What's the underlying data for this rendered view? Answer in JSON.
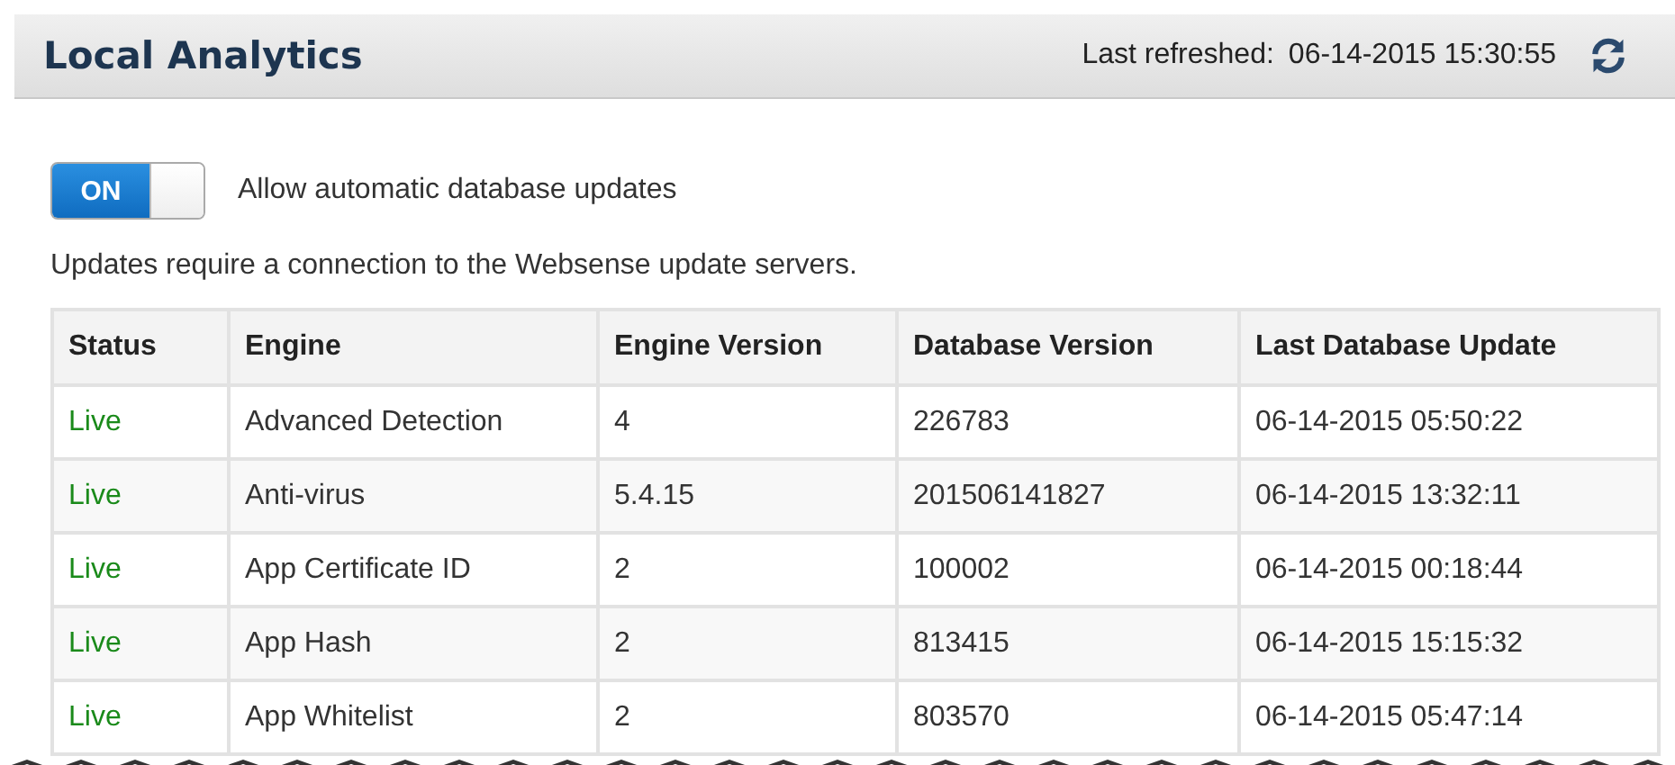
{
  "header": {
    "title": "Local Analytics",
    "refreshed_label": "Last refreshed:",
    "refreshed_time": "06-14-2015 15:30:55"
  },
  "toggle": {
    "on": true,
    "label": "ON",
    "caption": "Allow automatic database updates"
  },
  "note": "Updates require a connection to the Websense update servers.",
  "table": {
    "columns": [
      "Status",
      "Engine",
      "Engine Version",
      "Database Version",
      "Last Database Update"
    ],
    "rows": [
      [
        "Live",
        "Advanced Detection",
        "4",
        "226783",
        "06-14-2015 05:50:22"
      ],
      [
        "Live",
        "Anti-virus",
        "5.4.15",
        "201506141827",
        "06-14-2015 13:32:11"
      ],
      [
        "Live",
        "App Certificate ID",
        "2",
        "100002",
        "06-14-2015 00:18:44"
      ],
      [
        "Live",
        "App Hash",
        "2",
        "813415",
        "06-14-2015 15:15:32"
      ],
      [
        "Live",
        "App Whitelist",
        "2",
        "803570",
        "06-14-2015 05:47:14"
      ]
    ]
  }
}
